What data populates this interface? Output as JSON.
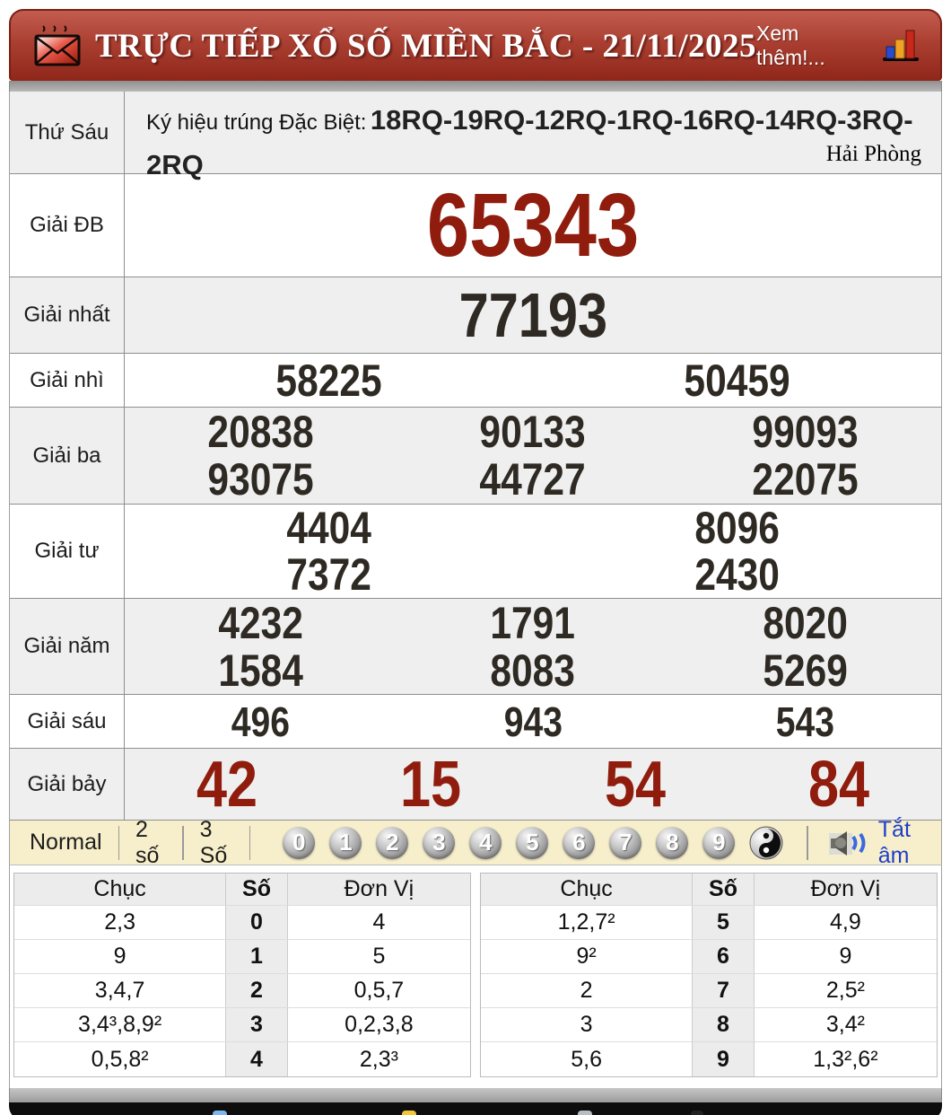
{
  "header": {
    "title": "TRỰC TIẾP XỔ SỐ MIỀN BẮC - 21/11/2025",
    "more": "Xem thêm!..."
  },
  "signature": {
    "day": "Thứ Sáu",
    "label": "Ký hiệu trúng Đặc Biệt:",
    "codes": "18RQ-19RQ-12RQ-1RQ-16RQ-14RQ-3RQ-2RQ",
    "province": "Hải Phòng"
  },
  "prizes": [
    {
      "kind": "db",
      "label": "Giải ĐB",
      "per_line": 1,
      "values": [
        "65343"
      ]
    },
    {
      "kind": "nhat",
      "label": "Giải nhất",
      "per_line": 1,
      "values": [
        "77193"
      ]
    },
    {
      "kind": "nhi",
      "label": "Giải nhì",
      "per_line": 2,
      "values": [
        "58225",
        "50459"
      ]
    },
    {
      "kind": "ba",
      "label": "Giải ba",
      "per_line": 3,
      "values": [
        "20838",
        "90133",
        "99093",
        "93075",
        "44727",
        "22075"
      ]
    },
    {
      "kind": "tu",
      "label": "Giải tư",
      "per_line": 2,
      "values": [
        "4404",
        "8096",
        "7372",
        "2430"
      ]
    },
    {
      "kind": "nam",
      "label": "Giải năm",
      "per_line": 3,
      "values": [
        "4232",
        "1791",
        "8020",
        "1584",
        "8083",
        "5269"
      ]
    },
    {
      "kind": "sau",
      "label": "Giải sáu",
      "per_line": 3,
      "values": [
        "496",
        "943",
        "543"
      ]
    },
    {
      "kind": "bay",
      "label": "Giải bảy",
      "per_line": 4,
      "values": [
        "42",
        "15",
        "54",
        "84"
      ]
    }
  ],
  "toolbar": {
    "modes": [
      "Normal",
      "2 số",
      "3 Số"
    ],
    "balls": [
      "0",
      "1",
      "2",
      "3",
      "4",
      "5",
      "6",
      "7",
      "8",
      "9"
    ],
    "mute_label": "Tắt âm"
  },
  "digit_tables": {
    "headers": {
      "tens": "Chục",
      "digit": "Số",
      "units": "Đơn Vị"
    },
    "left": [
      {
        "tens": "2,3",
        "digit": "0",
        "units": "4"
      },
      {
        "tens": "9",
        "digit": "1",
        "units": "5"
      },
      {
        "tens": "3,4,7",
        "digit": "2",
        "units": "0,5,7"
      },
      {
        "tens": "3,4³,8,9²",
        "digit": "3",
        "units": "0,2,3,8"
      },
      {
        "tens": "0,5,8²",
        "digit": "4",
        "units": "2,3³"
      }
    ],
    "right": [
      {
        "tens": "1,2,7²",
        "digit": "5",
        "units": "4,9"
      },
      {
        "tens": "9²",
        "digit": "6",
        "units": "9"
      },
      {
        "tens": "2",
        "digit": "7",
        "units": "2,5²"
      },
      {
        "tens": "3",
        "digit": "8",
        "units": "3,4²"
      },
      {
        "tens": "5,6",
        "digit": "9",
        "units": "1,3²,6²"
      }
    ]
  },
  "colors": {
    "accent_red": "#8f1c0d",
    "header_red": "#a63a2c",
    "toolbar_bg": "#f7efcb",
    "link_blue": "#1d3ecb"
  }
}
